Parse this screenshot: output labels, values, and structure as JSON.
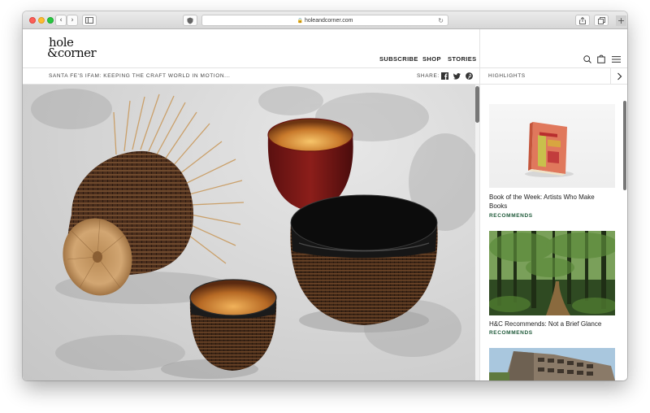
{
  "browser": {
    "url": "holeandcorner.com",
    "back_glyph": "‹",
    "forward_glyph": "›"
  },
  "header": {
    "logo_line1": "hole",
    "logo_line2": "&corner",
    "nav": {
      "subscribe": "SUBSCRIBE",
      "shop": "SHOP",
      "stories": "STORIES"
    },
    "icons": [
      "search-icon",
      "bag-icon",
      "menu-icon"
    ]
  },
  "subbar": {
    "headline": "SANTA FE'S IFAM: KEEPING THE CRAFT WORLD IN MOTION...",
    "share_label": "SHARE:",
    "share_icons": [
      "facebook-icon",
      "twitter-icon",
      "pinterest-icon"
    ]
  },
  "sidebar": {
    "title": "HIGHLIGHTS",
    "cards": [
      {
        "title_line1": "Book of the Week: Artists Who Make",
        "title_line2": "Books",
        "tag": "RECOMMENDS"
      },
      {
        "title_line1": "H&C Recommends: Not a Brief Glance",
        "tag": "RECOMMENDS"
      }
    ]
  },
  "colors": {
    "accent_tag": "#1f5a3a",
    "red_light": "#fc5f57",
    "yellow_light": "#fdbc2e",
    "green_light": "#28c840"
  }
}
